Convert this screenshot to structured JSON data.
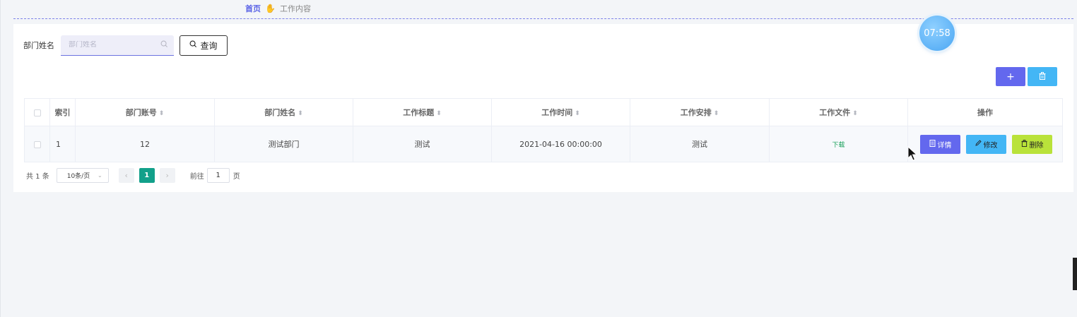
{
  "breadcrumb": {
    "home": "首页",
    "separator_icon": "hand-icon",
    "current": "工作内容"
  },
  "search": {
    "label": "部门姓名",
    "placeholder": "部门姓名",
    "value": "",
    "button_label": "查询"
  },
  "timer": {
    "text": "07:58"
  },
  "actions": {
    "add_icon": "+",
    "delete_icon": "trash-icon"
  },
  "table": {
    "columns": [
      "索引",
      "部门账号",
      "部门姓名",
      "工作标题",
      "工作时间",
      "工作安排",
      "工作文件",
      "操作"
    ],
    "rows": [
      {
        "index": "1",
        "dept_account": "12",
        "dept_name": "测试部门",
        "title": "测试",
        "time": "2021-04-16 00:00:00",
        "arrangement": "测试",
        "file_link": "下载",
        "ops": {
          "detail": "详情",
          "edit": "修改",
          "delete": "删除"
        }
      }
    ]
  },
  "pagination": {
    "total": "共 1 条",
    "page_size": "10条/页",
    "current_page": "1",
    "goto_label": "前往",
    "goto_value": "1",
    "goto_suffix": "页"
  },
  "colors": {
    "primary": "#6368ee",
    "info": "#43b6f5",
    "success": "#b9e23a",
    "page_active": "#12a08a"
  }
}
